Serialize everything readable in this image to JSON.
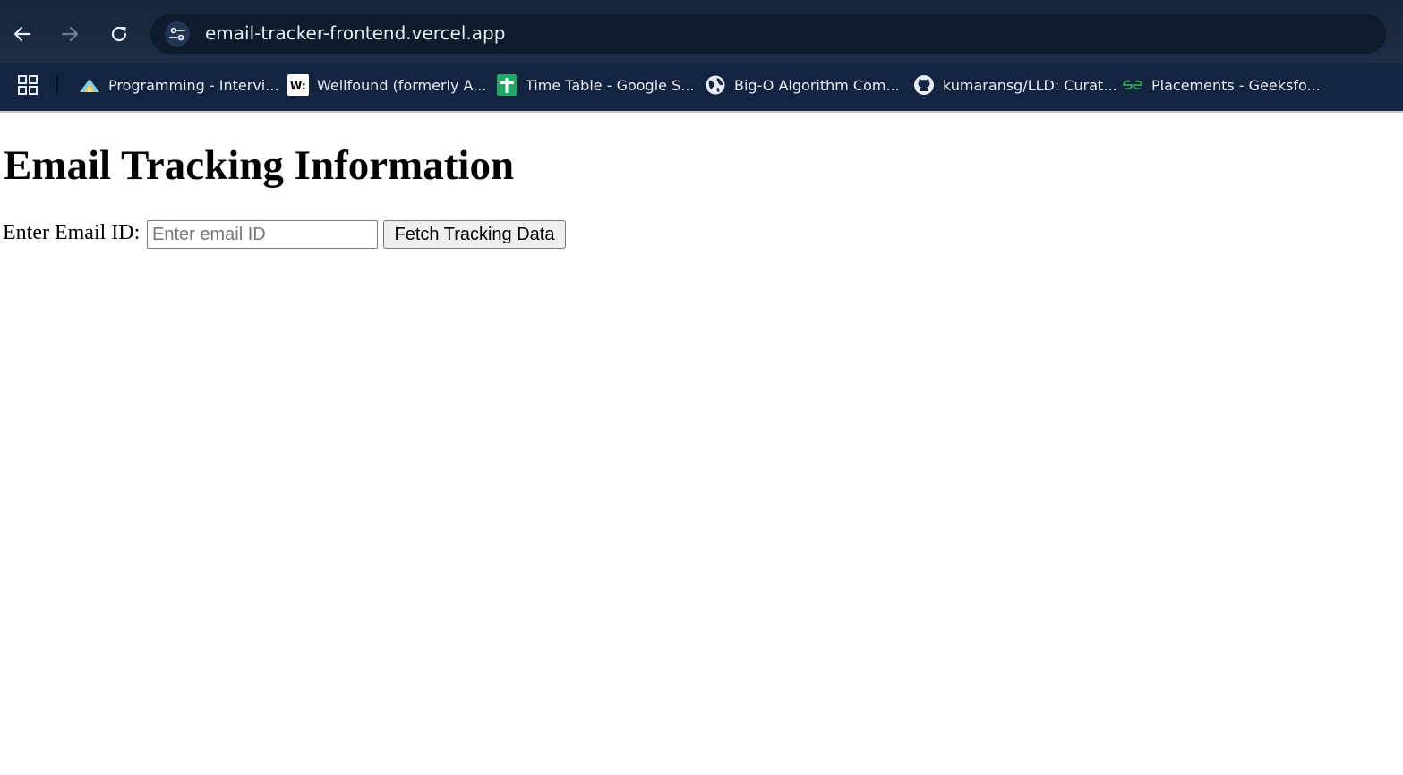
{
  "browser": {
    "url": "email-tracker-frontend.vercel.app",
    "bookmarks": [
      {
        "label": "Programming - Intervi...",
        "icon": "interviewbit-icon"
      },
      {
        "label": "Wellfound (formerly A...",
        "icon": "wellfound-icon"
      },
      {
        "label": "Time Table - Google S...",
        "icon": "google-sheets-icon"
      },
      {
        "label": "Big-O Algorithm Com...",
        "icon": "globe-icon"
      },
      {
        "label": "kumaransg/LLD: Curat...",
        "icon": "github-icon"
      },
      {
        "label": "Placements - Geeksfo...",
        "icon": "geeksforgeeks-icon"
      }
    ]
  },
  "page": {
    "title": "Email Tracking Information",
    "email_label": "Enter Email ID:",
    "email_placeholder": "Enter email ID",
    "email_value": "",
    "fetch_button": "Fetch Tracking Data"
  }
}
